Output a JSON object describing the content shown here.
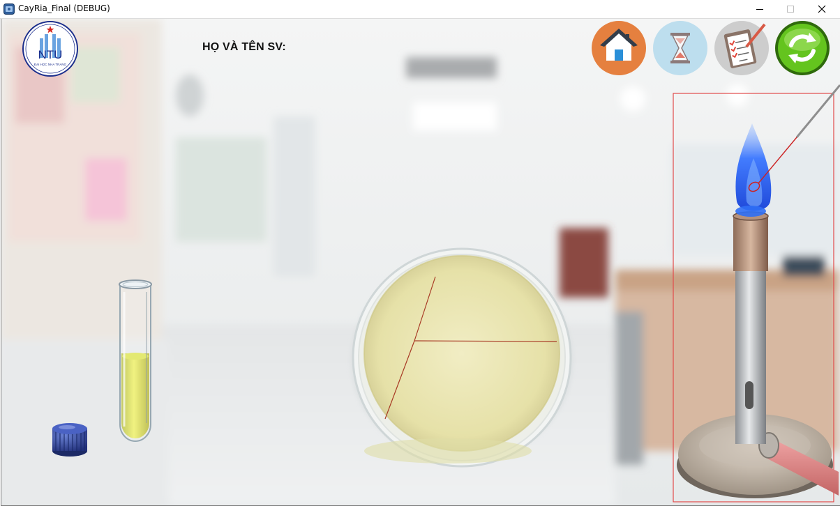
{
  "window": {
    "title": "CayRia_Final (DEBUG)",
    "controls": [
      "minimize",
      "maximize",
      "close"
    ]
  },
  "logo": {
    "text": "NTU",
    "subtitle": "ĐẠI HỌC NHA TRANG",
    "icon": "ntu-logo"
  },
  "student": {
    "label": "HỌ VÀ TÊN SV:",
    "name": ""
  },
  "toolbar": {
    "buttons": [
      {
        "name": "home",
        "icon": "home-icon",
        "color": "#e8803a"
      },
      {
        "name": "timer",
        "icon": "hourglass-icon",
        "color": "#a9d3ea"
      },
      {
        "name": "checklist",
        "icon": "clipboard-icon",
        "color": "#b8b8b8"
      },
      {
        "name": "refresh",
        "icon": "refresh-icon",
        "color": "#5cc21c"
      }
    ]
  },
  "lab_items": {
    "test_tube": {
      "icon": "test-tube-icon",
      "liquid_color": "#d9de4a"
    },
    "cap": {
      "icon": "tube-cap-icon",
      "color": "#3b4f9e"
    },
    "petri_dish": {
      "icon": "petri-dish-icon",
      "agar_color": "#ebe7b7",
      "streak_color": "#a83a25"
    },
    "burner": {
      "icon": "bunsen-burner-icon",
      "flame_color": "#1e5cf0"
    },
    "inoculation_loop": {
      "icon": "inoculation-loop-icon",
      "color": "#cc2222"
    }
  }
}
